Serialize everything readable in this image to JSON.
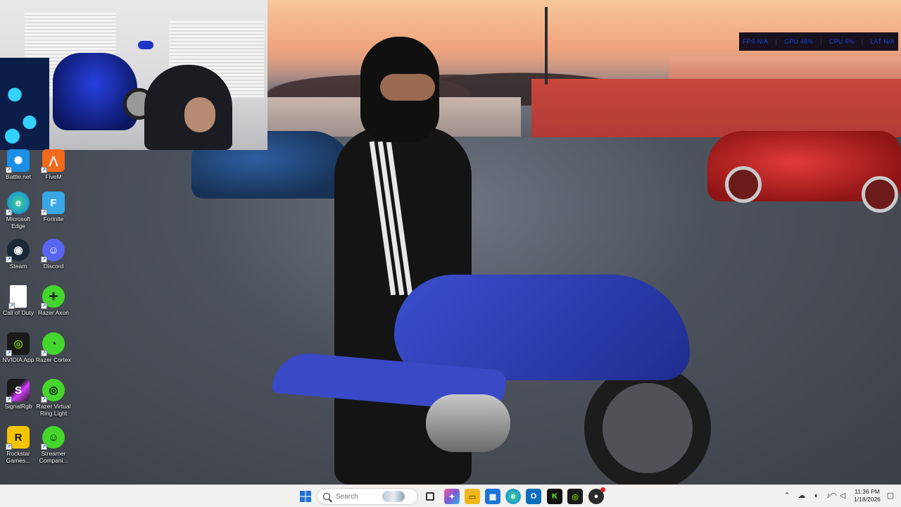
{
  "perf_overlay": {
    "items": [
      "FPS N/A",
      "GPU 46%",
      "CPU 6%",
      "LAT N/A"
    ]
  },
  "desktop_icons": [
    {
      "label": "Battle.net",
      "icon": "battlenet-icon",
      "color": "#1b8fe6"
    },
    {
      "label": "FiveM",
      "icon": "fivem-icon",
      "color": "#f26a1b"
    },
    {
      "label": "Microsoft Edge",
      "icon": "edge-icon",
      "color": "#1fa3c8"
    },
    {
      "label": "Fortnite",
      "icon": "fortnite-icon",
      "color": "#3aa7e6"
    },
    {
      "label": "Steam",
      "icon": "steam-icon",
      "color": "#1b2838"
    },
    {
      "label": "Discord",
      "icon": "discord-icon",
      "color": "#5865f2"
    },
    {
      "label": "Call of Duty",
      "icon": "document-icon",
      "color": "#ffffff"
    },
    {
      "label": "Razer Axon",
      "icon": "razer-axon-icon",
      "color": "#44d62c"
    },
    {
      "label": "NVIDIA App",
      "icon": "nvidia-icon",
      "color": "#1a1a1a"
    },
    {
      "label": "Razer Cortex",
      "icon": "razer-cortex-icon",
      "color": "#44d62c"
    },
    {
      "label": "SignalRgb",
      "icon": "signalrgb-icon",
      "color": "#1a1a1a"
    },
    {
      "label": "Razer Virtual Ring Light",
      "icon": "razer-ring-light-icon",
      "color": "#44d62c"
    },
    {
      "label": "Rockstar Games...",
      "icon": "rockstar-icon",
      "color": "#f5c400"
    },
    {
      "label": "Streamer Compani...",
      "icon": "streamer-companion-icon",
      "color": "#44d62c"
    }
  ],
  "taskbar": {
    "search_placeholder": "Search",
    "pinned": [
      {
        "icon": "start-icon",
        "color": "#1e6fd9"
      },
      {
        "icon": "task-view-icon",
        "color": "#333333"
      },
      {
        "icon": "copilot-icon",
        "color": "#7b5bd6"
      },
      {
        "icon": "file-explorer-icon",
        "color": "#f2b61d"
      },
      {
        "icon": "store-icon",
        "color": "#1d74d6"
      },
      {
        "icon": "edge-icon",
        "color": "#1fa3c8"
      },
      {
        "icon": "outlook-icon",
        "color": "#0f6cbd"
      },
      {
        "icon": "kick-icon",
        "color": "#53fc18"
      },
      {
        "icon": "nvidia-icon",
        "color": "#1a1a1a"
      },
      {
        "icon": "obs-icon",
        "color": "#2b2b2b"
      }
    ],
    "tray_icons": [
      "chevron-up-icon",
      "cloud-icon",
      "volume-icon",
      "microphone-icon",
      "wifi-icon",
      "speaker-icon"
    ],
    "clock": {
      "time": "11:36 PM",
      "date": "1/18/2026"
    }
  }
}
